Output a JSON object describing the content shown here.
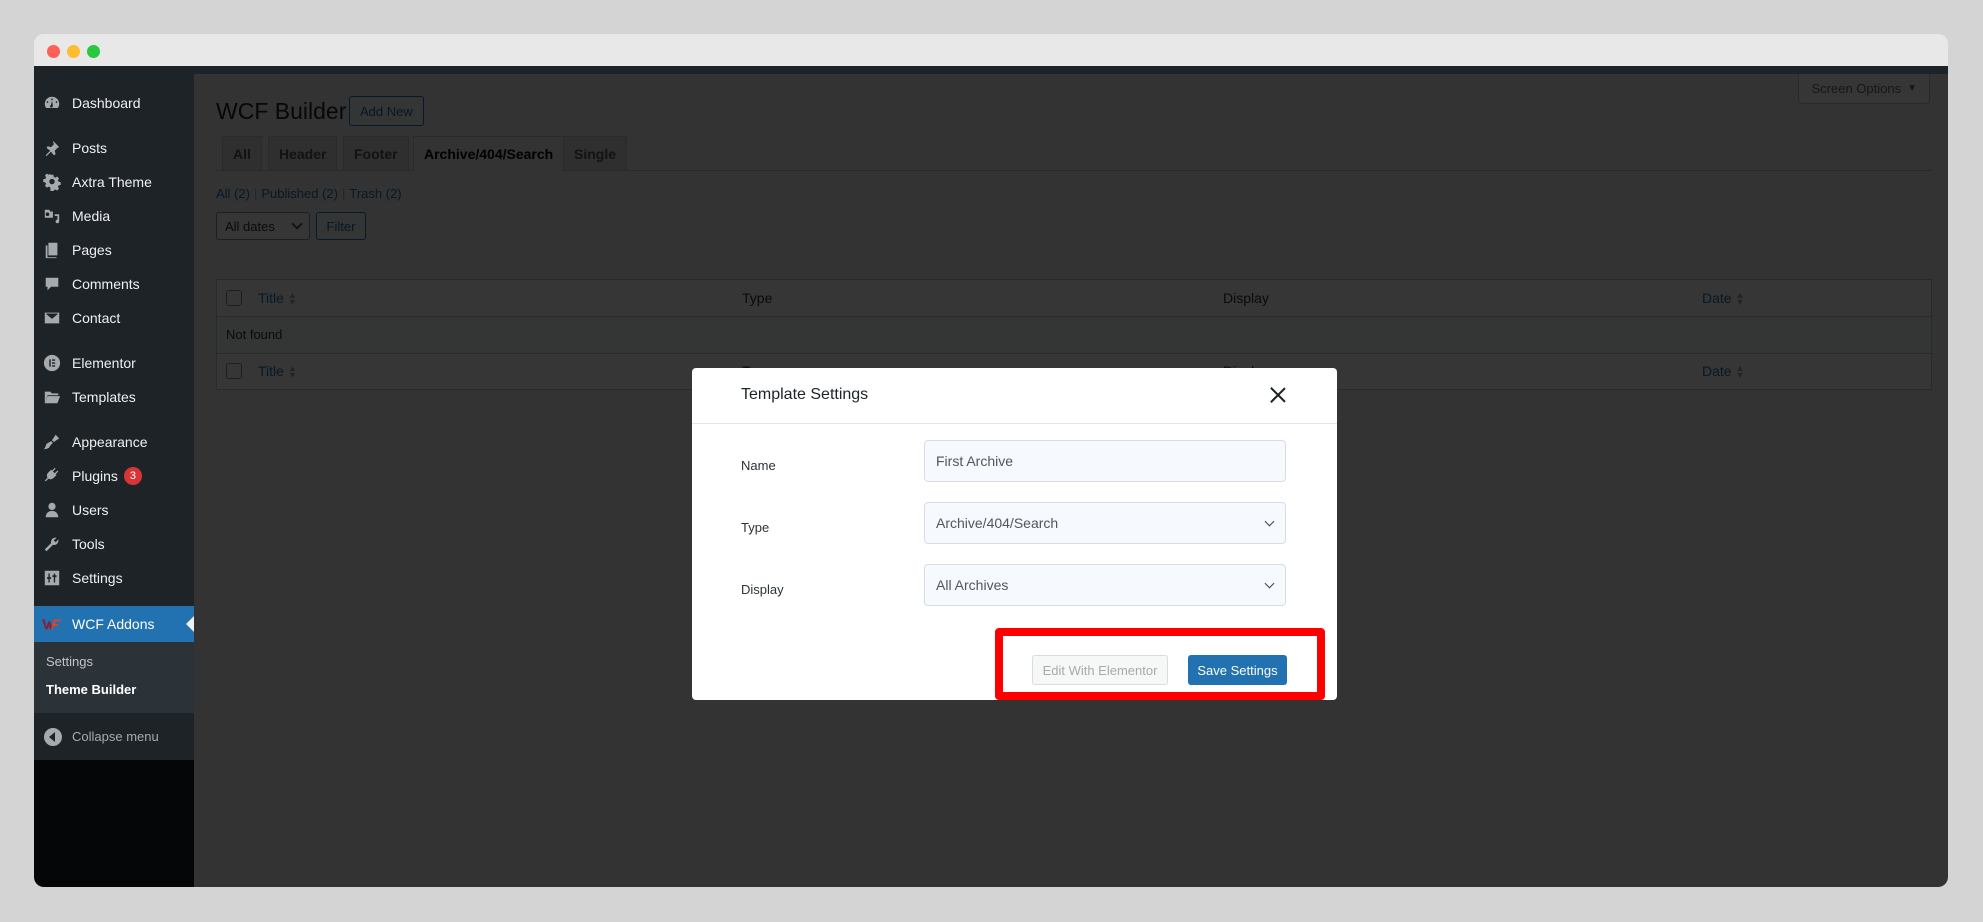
{
  "window": {
    "controls": [
      "close",
      "minimize",
      "maximize"
    ]
  },
  "sidebar": {
    "items": [
      {
        "label": "Dashboard",
        "icon": "dashboard-icon"
      },
      {
        "label": "Posts",
        "icon": "pin-icon"
      },
      {
        "label": "Axtra Theme",
        "icon": "gear-icon"
      },
      {
        "label": "Media",
        "icon": "media-icon"
      },
      {
        "label": "Pages",
        "icon": "pages-icon"
      },
      {
        "label": "Comments",
        "icon": "comment-icon"
      },
      {
        "label": "Contact",
        "icon": "envelope-icon"
      },
      {
        "label": "Elementor",
        "icon": "elementor-icon"
      },
      {
        "label": "Templates",
        "icon": "folder-icon"
      },
      {
        "label": "Appearance",
        "icon": "paintbrush-icon"
      },
      {
        "label": "Plugins",
        "icon": "plug-icon",
        "badge": "3"
      },
      {
        "label": "Users",
        "icon": "user-icon"
      },
      {
        "label": "Tools",
        "icon": "wrench-icon"
      },
      {
        "label": "Settings",
        "icon": "sliders-icon"
      },
      {
        "label": "WCF Addons",
        "icon": "wcf-logo-icon",
        "active": true
      }
    ],
    "submenu": [
      {
        "label": "Settings",
        "current": false
      },
      {
        "label": "Theme Builder",
        "current": true
      }
    ],
    "collapse_label": "Collapse menu"
  },
  "page": {
    "title": "WCF Builder",
    "add_new_label": "Add New",
    "screen_options_label": "Screen Options",
    "tabs": [
      {
        "label": "All",
        "active": false
      },
      {
        "label": "Header",
        "active": false
      },
      {
        "label": "Footer",
        "active": false
      },
      {
        "label": "Archive/404/Search",
        "active": true
      },
      {
        "label": "Single",
        "active": false
      }
    ],
    "views": [
      {
        "label": "All",
        "count": "(2)"
      },
      {
        "label": "Published",
        "count": "(2)"
      },
      {
        "label": "Trash",
        "count": "(2)"
      }
    ],
    "date_filter": "All dates",
    "filter_label": "Filter",
    "table": {
      "columns": [
        "Title",
        "Type",
        "Display",
        "Date"
      ],
      "empty_message": "Not found"
    }
  },
  "modal": {
    "title": "Template Settings",
    "fields": [
      {
        "label": "Name",
        "value": "First Archive",
        "kind": "text"
      },
      {
        "label": "Type",
        "value": "Archive/404/Search",
        "kind": "select"
      },
      {
        "label": "Display",
        "value": "All Archives",
        "kind": "select"
      }
    ],
    "edit_button_label": "Edit With Elementor",
    "save_button_label": "Save Settings"
  },
  "annotation": {
    "highlight_color": "#ff0000",
    "target": "modal-actions"
  },
  "colors": {
    "accent": "#2271b1",
    "sidebar_bg": "#1d2327",
    "badge": "#d63638"
  }
}
